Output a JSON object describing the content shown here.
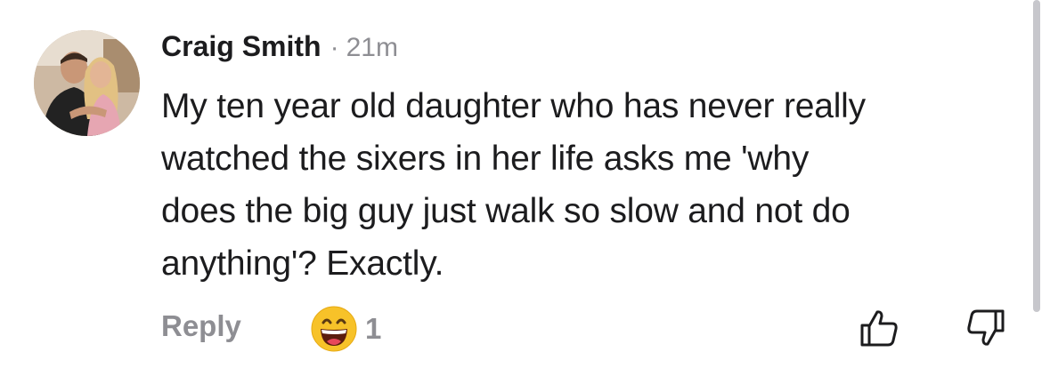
{
  "comment": {
    "author": "Craig Smith",
    "separator": "·",
    "time": "21m",
    "text_lines": [
      "My ten year old daughter who has never really",
      "watched the sixers in her life asks me 'why",
      "does the big guy just walk so slow and not do",
      "anything'? Exactly."
    ],
    "reply_label": "Reply",
    "reaction": {
      "icon": "grinning-face-emoji-icon",
      "count": "1"
    },
    "like_icon": "thumbs-up-icon",
    "dislike_icon": "thumbs-down-icon"
  },
  "colors": {
    "text": "#1c1c1e",
    "secondary": "#8e8e93",
    "emoji_face": "#f7c229",
    "scrollbar": "#c7c7cc"
  }
}
